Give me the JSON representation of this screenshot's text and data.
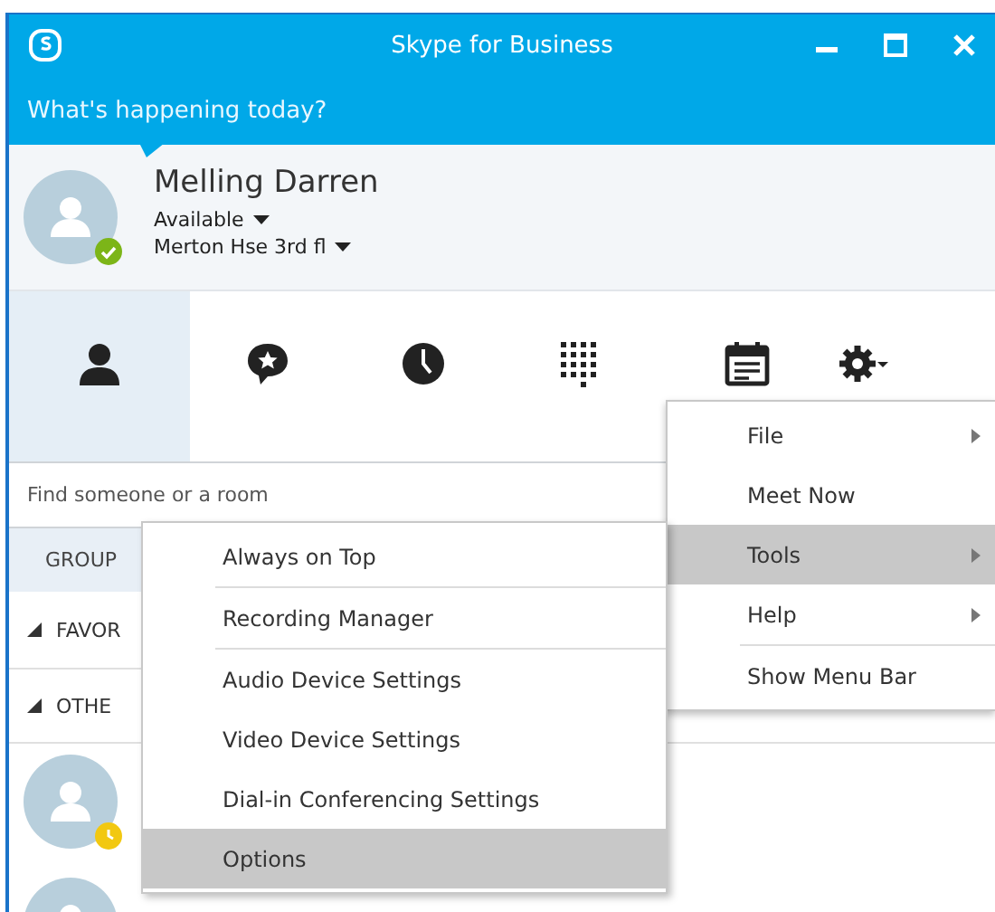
{
  "window": {
    "title": "Skype for Business"
  },
  "note": {
    "placeholder": "What's happening today?"
  },
  "user": {
    "name": "Melling Darren",
    "status": "Available",
    "location": "Merton Hse 3rd fl",
    "badge": {
      "kind": "check",
      "color": "#7cb518"
    }
  },
  "toolbar": [
    {
      "kind": "contacts",
      "selected": true
    },
    {
      "kind": "conversations",
      "selected": false
    },
    {
      "kind": "recent",
      "selected": false
    },
    {
      "kind": "dialpad",
      "selected": false
    },
    {
      "kind": "meetings",
      "selected": false
    },
    {
      "kind": "options",
      "selected": false
    }
  ],
  "search": {
    "placeholder": "Find someone or a room"
  },
  "list_header": {
    "label": "GROUP"
  },
  "groups": [
    {
      "label": "FAVOR",
      "expanded": true
    },
    {
      "label": "OTHE",
      "expanded": true
    }
  ],
  "contacts": [
    {
      "kind": "avatar",
      "badge": {
        "kind": "clock",
        "color": "#f2c811"
      }
    },
    {
      "kind": "avatar"
    }
  ],
  "menu": [
    {
      "label": "File",
      "has_submenu": true,
      "selected": false,
      "divider_after": false
    },
    {
      "label": "Meet Now",
      "has_submenu": false,
      "selected": false,
      "divider_after": false
    },
    {
      "label": "Tools",
      "has_submenu": true,
      "selected": true,
      "divider_after": false
    },
    {
      "label": "Help",
      "has_submenu": true,
      "selected": false,
      "divider_after": true
    },
    {
      "label": "Show Menu Bar",
      "has_submenu": false,
      "selected": false,
      "divider_after": false
    }
  ],
  "submenu": [
    {
      "label": "Always on Top",
      "selected": false,
      "divider_after": true
    },
    {
      "label": "Recording Manager",
      "selected": false,
      "divider_after": true
    },
    {
      "label": "Audio Device Settings",
      "selected": false,
      "divider_after": false
    },
    {
      "label": "Video Device Settings",
      "selected": false,
      "divider_after": false
    },
    {
      "label": "Dial-in Conferencing Settings",
      "selected": false,
      "divider_after": false
    },
    {
      "label": "Options",
      "selected": true,
      "divider_after": false
    }
  ]
}
